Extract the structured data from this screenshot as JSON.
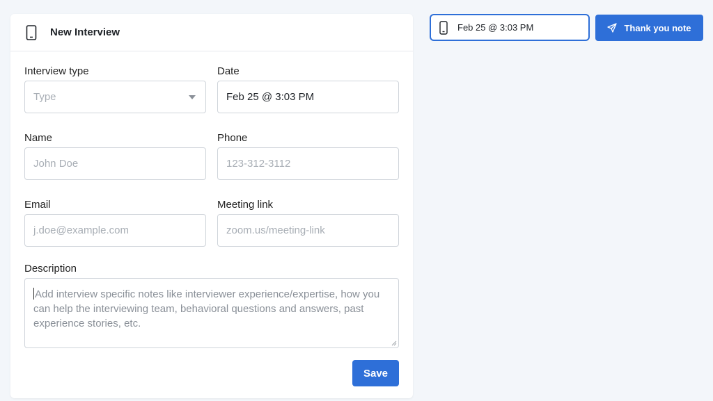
{
  "form": {
    "title": "New Interview",
    "interview_type": {
      "label": "Interview type",
      "placeholder": "Type"
    },
    "date": {
      "label": "Date",
      "value": "Feb 25 @ 3:03 PM"
    },
    "name": {
      "label": "Name",
      "placeholder": "John Doe"
    },
    "phone": {
      "label": "Phone",
      "placeholder": "123-312-3112"
    },
    "email": {
      "label": "Email",
      "placeholder": "j.doe@example.com"
    },
    "meeting_link": {
      "label": "Meeting link",
      "placeholder": "zoom.us/meeting-link"
    },
    "description": {
      "label": "Description",
      "placeholder": "Add interview specific notes like interviewer experience/expertise, how you can help the interviewing team, behavioral questions and answers, past experience stories, etc."
    },
    "save_label": "Save"
  },
  "side": {
    "date_chip": "Feb 25 @ 3:03 PM",
    "thank_you_label": "Thank you note"
  },
  "icons": {
    "header": "phone-icon",
    "chip": "phone-icon",
    "thanks": "send-icon"
  },
  "colors": {
    "accent": "#2e6fd8",
    "background": "#f3f6fa"
  }
}
